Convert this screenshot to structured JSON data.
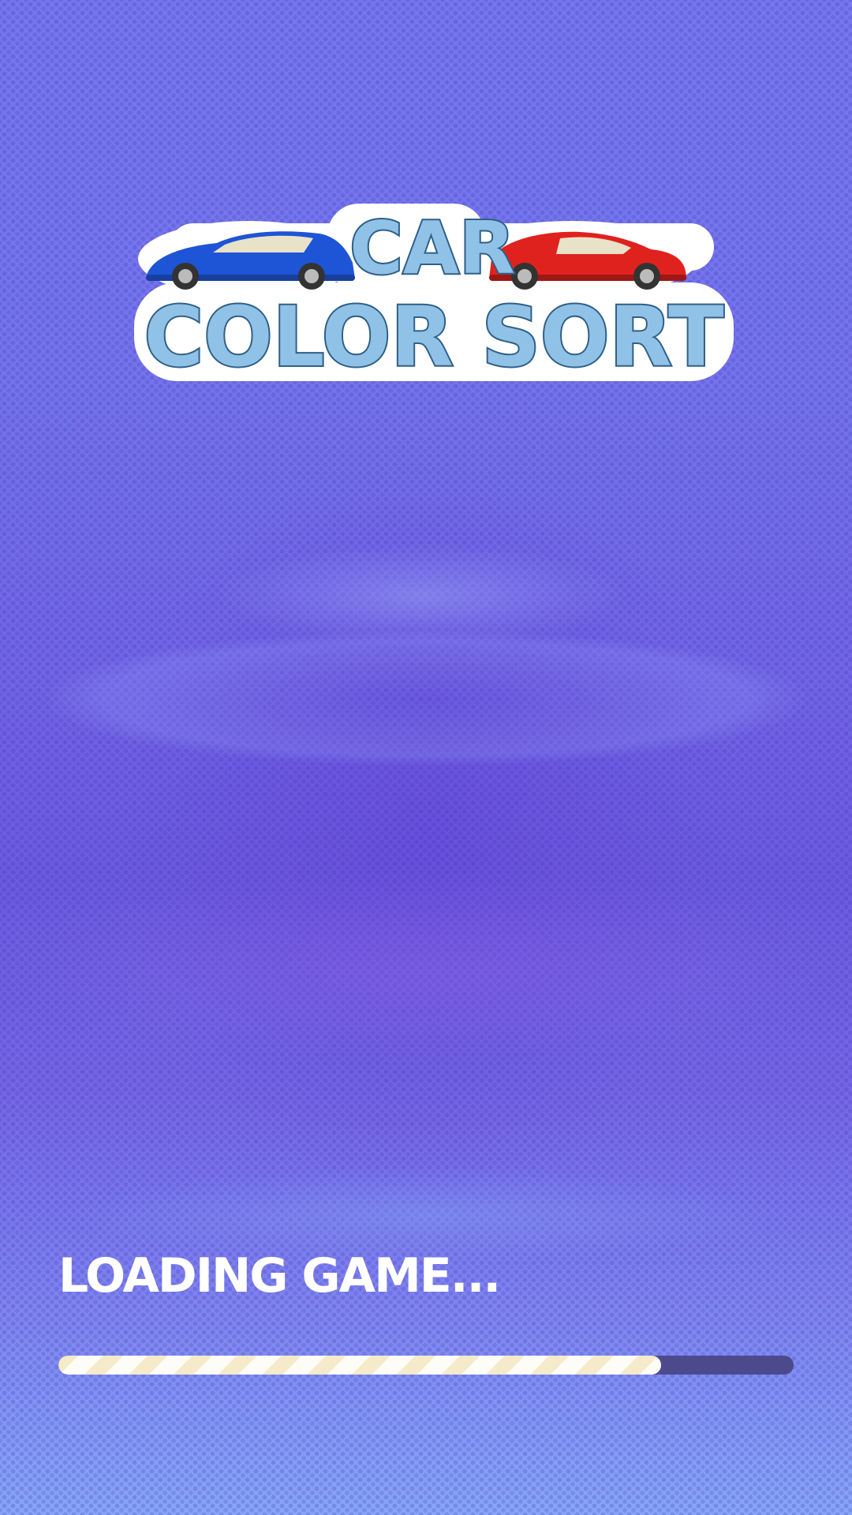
{
  "game": {
    "title_line1": "CAR",
    "title_line2": "COLOR SORT",
    "logo_cars": [
      "blue-car",
      "red-car"
    ]
  },
  "loading": {
    "label": "LOADING GAME...",
    "progress": 0.82
  },
  "colors": {
    "background": "#7474ec",
    "progress_track": "#4c4a8c",
    "progress_fill": "#fdfcf6",
    "logo_letters": "#8fc2e6",
    "blue_car": "#1e55d6",
    "red_car": "#e0221f"
  }
}
